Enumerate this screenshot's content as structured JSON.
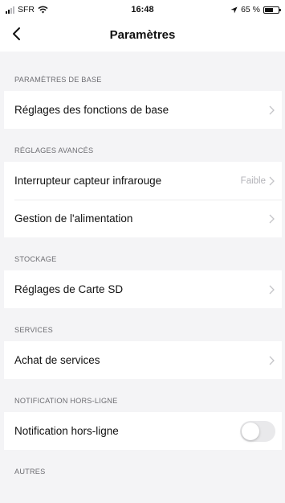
{
  "status_bar": {
    "carrier": "SFR",
    "time": "16:48",
    "battery": "65 %",
    "battery_level": 0.65
  },
  "nav": {
    "title": "Paramètres"
  },
  "sections": [
    {
      "header": "PARAMÈTRES DE BASE",
      "rows": [
        {
          "label": "Réglages des fonctions de base",
          "value": "",
          "type": "chevron"
        }
      ]
    },
    {
      "header": "RÉGLAGES AVANCÉS",
      "rows": [
        {
          "label": "Interrupteur capteur infrarouge",
          "value": "Faible",
          "type": "chevron"
        },
        {
          "label": "Gestion de l'alimentation",
          "value": "",
          "type": "chevron"
        }
      ]
    },
    {
      "header": "STOCKAGE",
      "rows": [
        {
          "label": "Réglages de Carte SD",
          "value": "",
          "type": "chevron"
        }
      ]
    },
    {
      "header": "SERVICES",
      "rows": [
        {
          "label": "Achat de services",
          "value": "",
          "type": "chevron"
        }
      ]
    },
    {
      "header": "NOTIFICATION HORS-LIGNE",
      "rows": [
        {
          "label": "Notification hors-ligne",
          "value": "",
          "type": "toggle",
          "on": false
        }
      ]
    },
    {
      "header": "AUTRES",
      "rows": []
    }
  ]
}
